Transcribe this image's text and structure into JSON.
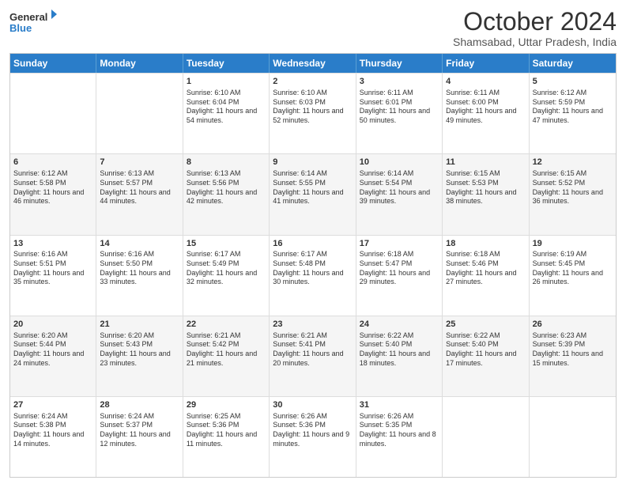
{
  "logo": {
    "line1": "General",
    "line2": "Blue"
  },
  "title": "October 2024",
  "location": "Shamsabad, Uttar Pradesh, India",
  "header_days": [
    "Sunday",
    "Monday",
    "Tuesday",
    "Wednesday",
    "Thursday",
    "Friday",
    "Saturday"
  ],
  "weeks": [
    [
      {
        "day": "",
        "sunrise": "",
        "sunset": "",
        "daylight": ""
      },
      {
        "day": "",
        "sunrise": "",
        "sunset": "",
        "daylight": ""
      },
      {
        "day": "1",
        "sunrise": "Sunrise: 6:10 AM",
        "sunset": "Sunset: 6:04 PM",
        "daylight": "Daylight: 11 hours and 54 minutes."
      },
      {
        "day": "2",
        "sunrise": "Sunrise: 6:10 AM",
        "sunset": "Sunset: 6:03 PM",
        "daylight": "Daylight: 11 hours and 52 minutes."
      },
      {
        "day": "3",
        "sunrise": "Sunrise: 6:11 AM",
        "sunset": "Sunset: 6:01 PM",
        "daylight": "Daylight: 11 hours and 50 minutes."
      },
      {
        "day": "4",
        "sunrise": "Sunrise: 6:11 AM",
        "sunset": "Sunset: 6:00 PM",
        "daylight": "Daylight: 11 hours and 49 minutes."
      },
      {
        "day": "5",
        "sunrise": "Sunrise: 6:12 AM",
        "sunset": "Sunset: 5:59 PM",
        "daylight": "Daylight: 11 hours and 47 minutes."
      }
    ],
    [
      {
        "day": "6",
        "sunrise": "Sunrise: 6:12 AM",
        "sunset": "Sunset: 5:58 PM",
        "daylight": "Daylight: 11 hours and 46 minutes."
      },
      {
        "day": "7",
        "sunrise": "Sunrise: 6:13 AM",
        "sunset": "Sunset: 5:57 PM",
        "daylight": "Daylight: 11 hours and 44 minutes."
      },
      {
        "day": "8",
        "sunrise": "Sunrise: 6:13 AM",
        "sunset": "Sunset: 5:56 PM",
        "daylight": "Daylight: 11 hours and 42 minutes."
      },
      {
        "day": "9",
        "sunrise": "Sunrise: 6:14 AM",
        "sunset": "Sunset: 5:55 PM",
        "daylight": "Daylight: 11 hours and 41 minutes."
      },
      {
        "day": "10",
        "sunrise": "Sunrise: 6:14 AM",
        "sunset": "Sunset: 5:54 PM",
        "daylight": "Daylight: 11 hours and 39 minutes."
      },
      {
        "day": "11",
        "sunrise": "Sunrise: 6:15 AM",
        "sunset": "Sunset: 5:53 PM",
        "daylight": "Daylight: 11 hours and 38 minutes."
      },
      {
        "day": "12",
        "sunrise": "Sunrise: 6:15 AM",
        "sunset": "Sunset: 5:52 PM",
        "daylight": "Daylight: 11 hours and 36 minutes."
      }
    ],
    [
      {
        "day": "13",
        "sunrise": "Sunrise: 6:16 AM",
        "sunset": "Sunset: 5:51 PM",
        "daylight": "Daylight: 11 hours and 35 minutes."
      },
      {
        "day": "14",
        "sunrise": "Sunrise: 6:16 AM",
        "sunset": "Sunset: 5:50 PM",
        "daylight": "Daylight: 11 hours and 33 minutes."
      },
      {
        "day": "15",
        "sunrise": "Sunrise: 6:17 AM",
        "sunset": "Sunset: 5:49 PM",
        "daylight": "Daylight: 11 hours and 32 minutes."
      },
      {
        "day": "16",
        "sunrise": "Sunrise: 6:17 AM",
        "sunset": "Sunset: 5:48 PM",
        "daylight": "Daylight: 11 hours and 30 minutes."
      },
      {
        "day": "17",
        "sunrise": "Sunrise: 6:18 AM",
        "sunset": "Sunset: 5:47 PM",
        "daylight": "Daylight: 11 hours and 29 minutes."
      },
      {
        "day": "18",
        "sunrise": "Sunrise: 6:18 AM",
        "sunset": "Sunset: 5:46 PM",
        "daylight": "Daylight: 11 hours and 27 minutes."
      },
      {
        "day": "19",
        "sunrise": "Sunrise: 6:19 AM",
        "sunset": "Sunset: 5:45 PM",
        "daylight": "Daylight: 11 hours and 26 minutes."
      }
    ],
    [
      {
        "day": "20",
        "sunrise": "Sunrise: 6:20 AM",
        "sunset": "Sunset: 5:44 PM",
        "daylight": "Daylight: 11 hours and 24 minutes."
      },
      {
        "day": "21",
        "sunrise": "Sunrise: 6:20 AM",
        "sunset": "Sunset: 5:43 PM",
        "daylight": "Daylight: 11 hours and 23 minutes."
      },
      {
        "day": "22",
        "sunrise": "Sunrise: 6:21 AM",
        "sunset": "Sunset: 5:42 PM",
        "daylight": "Daylight: 11 hours and 21 minutes."
      },
      {
        "day": "23",
        "sunrise": "Sunrise: 6:21 AM",
        "sunset": "Sunset: 5:41 PM",
        "daylight": "Daylight: 11 hours and 20 minutes."
      },
      {
        "day": "24",
        "sunrise": "Sunrise: 6:22 AM",
        "sunset": "Sunset: 5:40 PM",
        "daylight": "Daylight: 11 hours and 18 minutes."
      },
      {
        "day": "25",
        "sunrise": "Sunrise: 6:22 AM",
        "sunset": "Sunset: 5:40 PM",
        "daylight": "Daylight: 11 hours and 17 minutes."
      },
      {
        "day": "26",
        "sunrise": "Sunrise: 6:23 AM",
        "sunset": "Sunset: 5:39 PM",
        "daylight": "Daylight: 11 hours and 15 minutes."
      }
    ],
    [
      {
        "day": "27",
        "sunrise": "Sunrise: 6:24 AM",
        "sunset": "Sunset: 5:38 PM",
        "daylight": "Daylight: 11 hours and 14 minutes."
      },
      {
        "day": "28",
        "sunrise": "Sunrise: 6:24 AM",
        "sunset": "Sunset: 5:37 PM",
        "daylight": "Daylight: 11 hours and 12 minutes."
      },
      {
        "day": "29",
        "sunrise": "Sunrise: 6:25 AM",
        "sunset": "Sunset: 5:36 PM",
        "daylight": "Daylight: 11 hours and 11 minutes."
      },
      {
        "day": "30",
        "sunrise": "Sunrise: 6:26 AM",
        "sunset": "Sunset: 5:36 PM",
        "daylight": "Daylight: 11 hours and 9 minutes."
      },
      {
        "day": "31",
        "sunrise": "Sunrise: 6:26 AM",
        "sunset": "Sunset: 5:35 PM",
        "daylight": "Daylight: 11 hours and 8 minutes."
      },
      {
        "day": "",
        "sunrise": "",
        "sunset": "",
        "daylight": ""
      },
      {
        "day": "",
        "sunrise": "",
        "sunset": "",
        "daylight": ""
      }
    ]
  ]
}
